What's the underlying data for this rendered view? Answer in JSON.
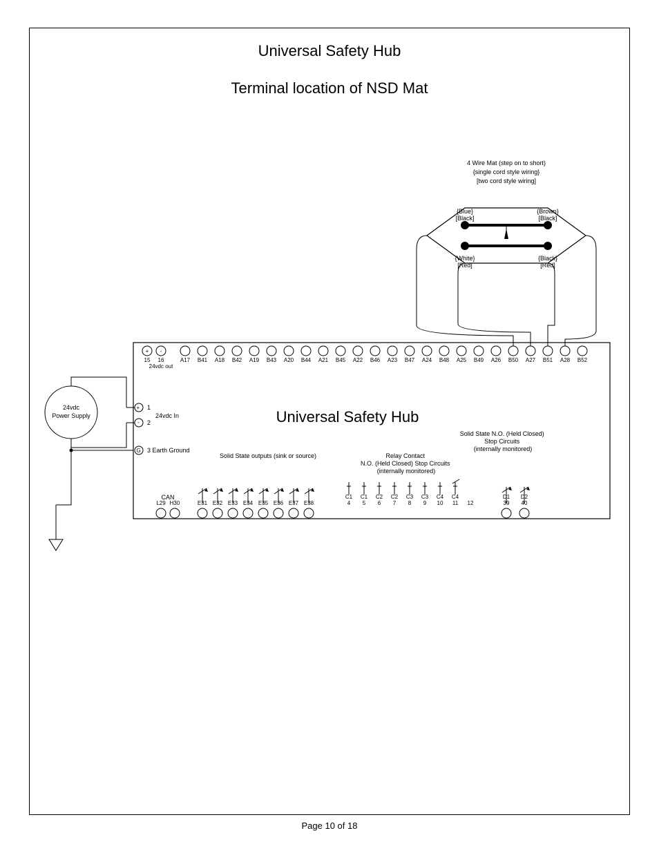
{
  "page": {
    "title1": "Universal Safety Hub",
    "title2": "Terminal location of NSD Mat",
    "footer": "Page 10 of  18"
  },
  "mat": {
    "header": [
      "4 Wire Mat (step on to short)",
      "{single cord style wiring}",
      "[two cord style wiring]"
    ],
    "tl": "{Blue}\n[Black]",
    "tr": "{Brown}\n[Black]",
    "bl": "{White}\n[Red]",
    "br": "{Black}\n[Red]"
  },
  "topRow": {
    "plus": "+",
    "minus": "-",
    "t15": "15",
    "t16": "16",
    "out24": "24vdc out",
    "pairs": [
      "A17",
      "B41",
      "A18",
      "B42",
      "A19",
      "B43",
      "A20",
      "B44",
      "A21",
      "B45",
      "A22",
      "B46",
      "A23",
      "B47",
      "A24",
      "B48",
      "A25",
      "B49",
      "A26",
      "B50",
      "A27",
      "B51",
      "A28",
      "B52"
    ]
  },
  "left": {
    "ps": "24vdc\nPower Supply",
    "plus": "+",
    "minus": "-",
    "g": "G",
    "in1": "1",
    "in2": "2",
    "in24": "24vdc In",
    "earth3": "3 Earth Ground"
  },
  "midLabel": "Universal Safety Hub",
  "sections": {
    "sso": "Solid State outputs (sink or source)",
    "relay": "Relay Contact\nN.O. (Held Closed) Stop Circuits\n(internally monitored)",
    "ssno": "Solid State N.O. (Held Closed)\nStop Circuits\n(internally monitored)"
  },
  "bottom": {
    "can": "CAN",
    "canTerms": [
      "L29",
      "H30"
    ],
    "eTerms": [
      "E31",
      "E32",
      "E33",
      "E34",
      "E35",
      "E36",
      "E37",
      "E38"
    ],
    "cTop": [
      "C1",
      "C1",
      "C2",
      "C2",
      "C3",
      "C3",
      "C4",
      "C4"
    ],
    "cBot": [
      "4",
      "5",
      "6",
      "7",
      "8",
      "9",
      "10",
      "11",
      "12"
    ],
    "cBotFull": [
      "4",
      "5",
      "6",
      "7",
      "8",
      "9",
      "10",
      "11",
      "12"
    ],
    "dTop": [
      "D1",
      "D2"
    ],
    "dBot": [
      "39",
      "40"
    ]
  }
}
